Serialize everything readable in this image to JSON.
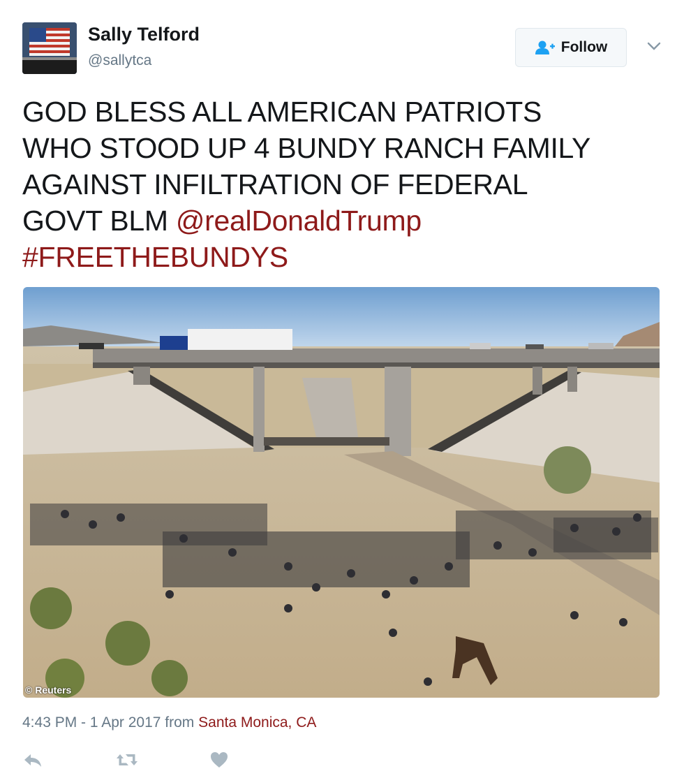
{
  "user": {
    "name": "Sally Telford",
    "handle": "@sallytca"
  },
  "follow_button": {
    "label": "Follow",
    "icon": "add-user-icon"
  },
  "menu_icon": "chevron-down-icon",
  "tweet": {
    "text_plain": "GOD BLESS ALL AMERICAN PATRIOTS WHO STOOD UP 4 BUNDY RANCH FAMILY AGAINST INFILTRATION OF FEDERAL GOVT BLM",
    "lines": [
      "GOD BLESS ALL AMERICAN PATRIOTS",
      "WHO STOOD UP 4 BUNDY RANCH FAMILY",
      "AGAINST INFILTRATION OF FEDERAL",
      "GOVT BLM "
    ],
    "mention": "@realDonaldTrump",
    "hashtag": "#FREETHEBUNDYS"
  },
  "photo": {
    "credit": "© Reuters"
  },
  "meta": {
    "time": "4:43 PM - 1 Apr 2017",
    "from": " from ",
    "location": "Santa Monica, CA"
  },
  "actions": [
    {
      "name": "reply",
      "icon": "reply-icon"
    },
    {
      "name": "retweet",
      "icon": "retweet-icon"
    },
    {
      "name": "like",
      "icon": "heart-icon"
    }
  ],
  "colors": {
    "link": "#8e1a1a",
    "muted": "#657786",
    "text": "#14171a",
    "follow_icon": "#1da1f2"
  }
}
